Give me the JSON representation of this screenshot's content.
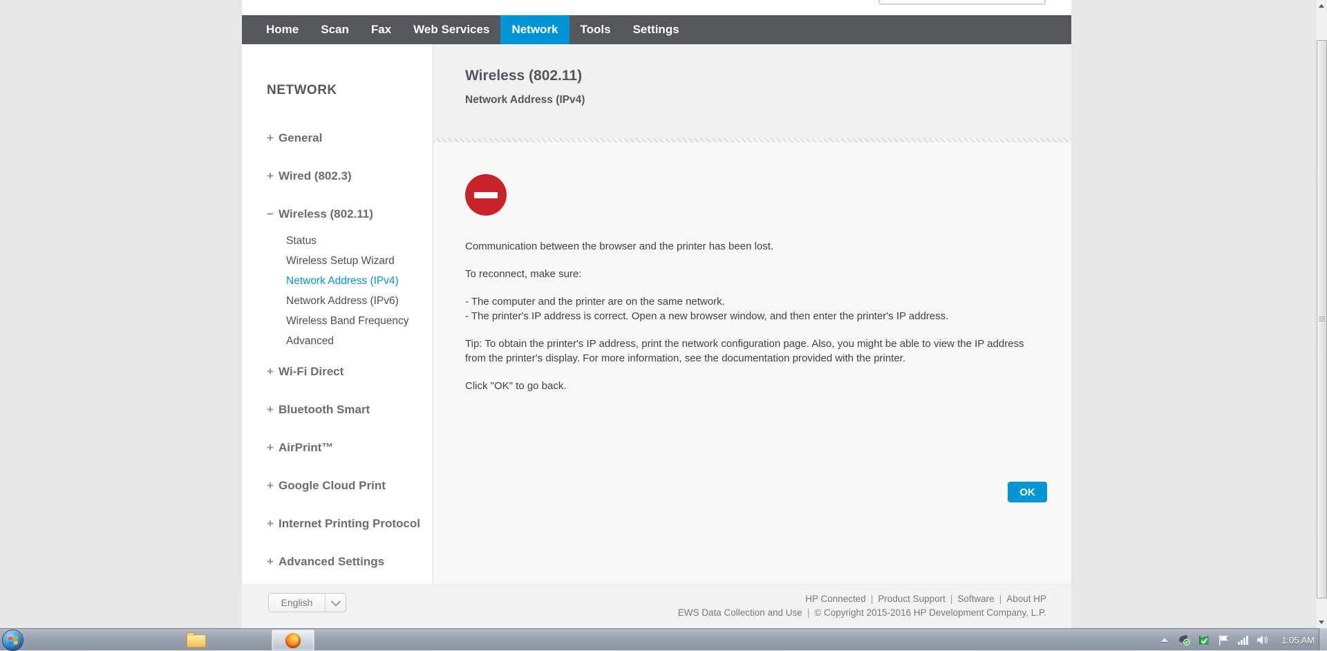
{
  "nav": {
    "tabs": [
      "Home",
      "Scan",
      "Fax",
      "Web Services",
      "Network",
      "Tools",
      "Settings"
    ],
    "active_tab": "Network"
  },
  "search": {
    "value": ""
  },
  "sidebar": {
    "title": "NETWORK",
    "items": [
      {
        "expander": "+",
        "label": "General"
      },
      {
        "expander": "+",
        "label": "Wired (802.3)"
      },
      {
        "expander": "−",
        "label": "Wireless (802.11)"
      },
      {
        "expander": "+",
        "label": "Wi-Fi Direct"
      },
      {
        "expander": "+",
        "label": "Bluetooth Smart"
      },
      {
        "expander": "+",
        "label": "AirPrint™"
      },
      {
        "expander": "+",
        "label": "Google Cloud Print"
      },
      {
        "expander": "+",
        "label": "Internet Printing Protocol"
      },
      {
        "expander": "+",
        "label": "Advanced Settings"
      }
    ],
    "wireless_children": [
      "Status",
      "Wireless Setup Wizard",
      "Network Address (IPv4)",
      "Network Address (IPv6)",
      "Wireless Band Frequency",
      "Advanced"
    ],
    "active_child": "Network Address (IPv4)"
  },
  "content": {
    "title": "Wireless (802.11)",
    "subtitle": "Network Address (IPv4)",
    "error_icon": "minus-circle",
    "message": "Communication between the browser and the printer has been lost.",
    "reconnect_intro": "To reconnect, make sure:",
    "checklist": [
      "- The computer and the printer are on the same network.",
      "- The printer's IP address is correct. Open a new browser window, and then enter the printer's IP address."
    ],
    "tip": "Tip: To obtain the printer's IP address, print the network configuration page. Also, you might be able to view the IP address from the printer's display. For more information, see the documentation provided with the printer.",
    "closing": "Click \"OK\" to go back.",
    "ok_label": "OK"
  },
  "footer": {
    "language": "English",
    "links": [
      "HP Connected",
      "Product Support",
      "Software",
      "About HP"
    ],
    "separator": "|",
    "line2_left": "EWS Data Collection and Use",
    "line2_right": "© Copyright 2015-2016 HP Development Company, L.P."
  },
  "taskbar": {
    "clock": "1:05 AM"
  },
  "colors": {
    "accent_blue": "#0096d6",
    "nav_gray": "#54565a",
    "error_red": "#c8232b"
  }
}
